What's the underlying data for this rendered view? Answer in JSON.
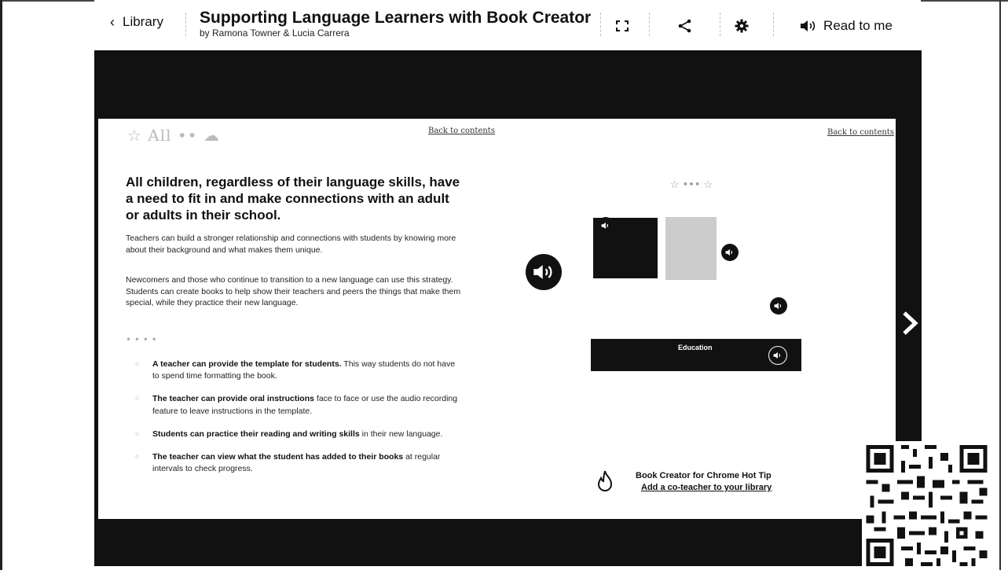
{
  "toolbar": {
    "back_label": "Library",
    "title": "Supporting Language Learners with Book Creator",
    "subtitle": "by Ramona Towner & Lucia Carrera",
    "read_label": "Read to me",
    "icons": [
      "fullscreen-icon",
      "share-icon",
      "gear-icon",
      "speaker-icon"
    ]
  },
  "page": {
    "back_to_contents": "Back to contents",
    "heading": "All children, regardless of their language skills, have a need to fit in and make connections with an adult or adults in their school.",
    "para1": "Teachers can build a stronger relationship and connections with students by knowing more about their background and what makes them unique.",
    "para2": "Newcomers and those who continue to transition to a new language can use this strategy. Students can create books to help show their teachers and peers the things that make them special, while they practice their new language.",
    "bullets": [
      {
        "bold": "A teacher can provide the template for students.",
        "rest": " This way students do not have to spend time formatting the book."
      },
      {
        "bold": "The teacher can provide oral instructions",
        "rest": " face to face or use the audio recording feature to leave instructions in the template."
      },
      {
        "bold": "Students can practice their reading and writing skills",
        "rest": " in their new language."
      },
      {
        "bold": "The teacher can view what the student has added to their books",
        "rest": " at regular intervals to check progress."
      }
    ],
    "preview": {
      "education_label": "Education"
    },
    "tip": {
      "title": "Book Creator for Chrome Hot Tip",
      "link": "Add a co-teacher to your library"
    }
  },
  "colors": {
    "stage": "#111111",
    "page": "#ffffff",
    "text": "#111111"
  }
}
